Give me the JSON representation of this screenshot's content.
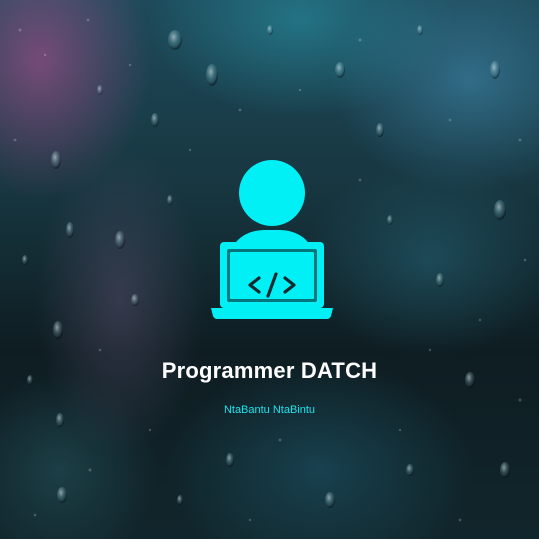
{
  "profile": {
    "name": "Programmer DATCH",
    "tagline": "NtaBantu NtaBintu",
    "avatar_icon": "programmer-laptop-icon",
    "accent_color": "#00f0f5"
  }
}
